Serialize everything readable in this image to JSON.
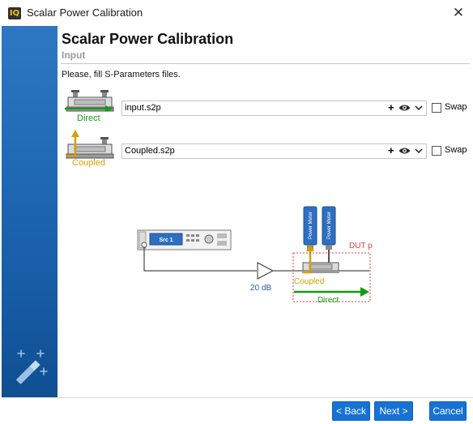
{
  "window": {
    "title": "Scalar Power Calibration",
    "app_icon_text": "IQ",
    "close_glyph": "✕"
  },
  "header": {
    "title": "Scalar Power Calibration",
    "subtitle": "Input"
  },
  "instruction": "Please, fill S-Parameters files.",
  "rows": [
    {
      "caption": "Direct",
      "caption_color": "#119c11",
      "file_value": "input.s2p",
      "swap_label": "Swap"
    },
    {
      "caption": "Coupled",
      "caption_color": "#d6a000",
      "file_value": "Coupled.s2p",
      "swap_label": "Swap"
    }
  ],
  "diagram": {
    "source_label": "Src 1",
    "power_meter_label": "Power Meter",
    "amp_gain": "20 dB",
    "dut_plane_label": "DUT plane",
    "coupled_label": "Coupled",
    "direct_label": "Direct"
  },
  "buttons": {
    "back": "< Back",
    "next": "Next >",
    "cancel": "Cancel"
  },
  "colors": {
    "accent": "#1673d6",
    "sidebar": "#1f68b4",
    "direct": "#119c11",
    "coupled": "#d6a000",
    "dut_plane": "#d94040",
    "amp_label": "#1f5fb0"
  },
  "icons": [
    "app-logo-icon",
    "close-icon",
    "add-icon",
    "eye-icon",
    "chevron-down-icon",
    "wand-icon",
    "coupler-direct-icon",
    "coupler-coupled-icon"
  ]
}
